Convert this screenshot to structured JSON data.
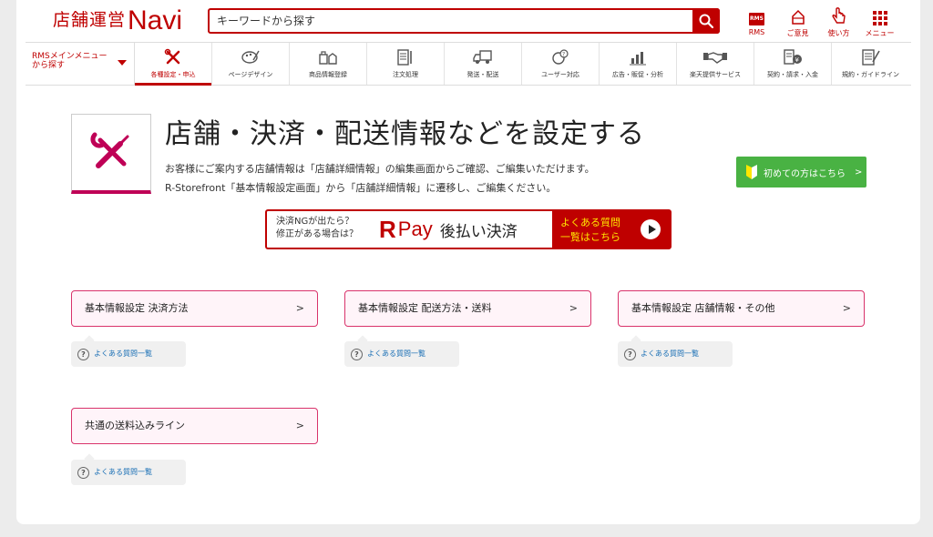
{
  "header": {
    "logo_jp": "店舗運営",
    "logo_en": "Navi",
    "search_placeholder": "キーワードから探す",
    "icons": [
      {
        "label": "RMS",
        "badge": "RMS",
        "icon": "rms-icon"
      },
      {
        "label": "ご意見",
        "icon": "feedback-icon"
      },
      {
        "label": "使い方",
        "icon": "hand-pointer-icon"
      },
      {
        "label": "メニュー",
        "icon": "grid-menu-icon"
      }
    ]
  },
  "nav": {
    "menu_label_1": "RMSメインメニュー",
    "menu_label_2": "から探す",
    "items": [
      {
        "label": "各種設定・申込",
        "icon": "tools-icon",
        "active": true
      },
      {
        "label": "ページデザイン",
        "icon": "palette-icon"
      },
      {
        "label": "商品情報登録",
        "icon": "products-icon"
      },
      {
        "label": "注文処理",
        "icon": "order-icon"
      },
      {
        "label": "発送・配送",
        "icon": "truck-icon"
      },
      {
        "label": "ユーザー対応",
        "icon": "user-support-icon"
      },
      {
        "label": "広告・販促・分析",
        "icon": "chart-icon"
      },
      {
        "label": "楽天提供サービス",
        "icon": "handshake-icon"
      },
      {
        "label": "契約・請求・入金",
        "icon": "contract-icon"
      },
      {
        "label": "規約・ガイドライン",
        "icon": "guideline-icon"
      }
    ]
  },
  "hero": {
    "title": "店舗・決済・配送情報などを設定する",
    "desc_line1": "お客様にご案内する店舗情報は「店舗詳細情報」の編集画面からご確認、ご編集いただけます。",
    "desc_line2": "R-Storefront「基本情報設定画面」から「店舗詳細情報」に遷移し、ご編集ください。",
    "beginner_label": "初めての方はこちら"
  },
  "banner": {
    "q_line1": "決済NGが出たら？",
    "q_line2": "修正がある場合は？",
    "rpay_r": "R",
    "rpay_pay": "Pay",
    "rpay_text": "後払い決済",
    "faq_line1": "よくある質問",
    "faq_line2": "一覧はこちら"
  },
  "cards": [
    {
      "label": "基本情報設定 決済方法",
      "faq": "よくある質問一覧"
    },
    {
      "label": "基本情報設定 配送方法・送料",
      "faq": "よくある質問一覧"
    },
    {
      "label": "基本情報設定 店舗情報・その他",
      "faq": "よくある質問一覧"
    },
    {
      "label": "共通の送料込みライン",
      "faq": "よくある質問一覧"
    }
  ],
  "colors": {
    "brand_red": "#bf0000",
    "card_border": "#d9336b",
    "card_bg": "#fff4f9",
    "green": "#49b243",
    "link_blue": "#1a6fb5"
  }
}
